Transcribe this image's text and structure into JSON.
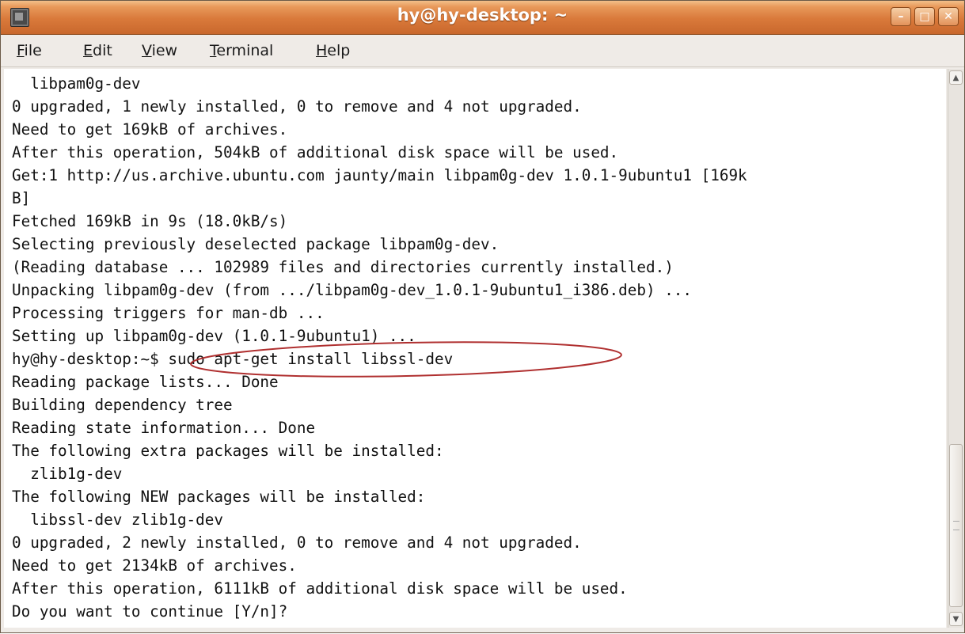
{
  "window": {
    "title": "hy@hy-desktop: ~",
    "buttons": {
      "minimize": "–",
      "maximize": "□",
      "close": "✕"
    },
    "icon": "terminal-app-icon"
  },
  "menubar": {
    "items": [
      {
        "underline": "F",
        "rest": "ile"
      },
      {
        "underline": "E",
        "rest": "dit"
      },
      {
        "underline": "V",
        "rest": "iew"
      },
      {
        "underline": "T",
        "rest": "erminal"
      },
      {
        "underline": "H",
        "rest": "elp"
      }
    ]
  },
  "terminal": {
    "lines": [
      "  libpam0g-dev",
      "0 upgraded, 1 newly installed, 0 to remove and 4 not upgraded.",
      "Need to get 169kB of archives.",
      "After this operation, 504kB of additional disk space will be used.",
      "Get:1 http://us.archive.ubuntu.com jaunty/main libpam0g-dev 1.0.1-9ubuntu1 [169k",
      "B]",
      "Fetched 169kB in 9s (18.0kB/s)",
      "Selecting previously deselected package libpam0g-dev.",
      "(Reading database ... 102989 files and directories currently installed.)",
      "Unpacking libpam0g-dev (from .../libpam0g-dev_1.0.1-9ubuntu1_i386.deb) ...",
      "Processing triggers for man-db ...",
      "Setting up libpam0g-dev (1.0.1-9ubuntu1) ...",
      "hy@hy-desktop:~$ sudo apt-get install libssl-dev",
      "Reading package lists... Done",
      "Building dependency tree",
      "Reading state information... Done",
      "The following extra packages will be installed:",
      "  zlib1g-dev",
      "The following NEW packages will be installed:",
      "  libssl-dev zlib1g-dev",
      "0 upgraded, 2 newly installed, 0 to remove and 4 not upgraded.",
      "Need to get 2134kB of archives.",
      "After this operation, 6111kB of additional disk space will be used.",
      "Do you want to continue [Y/n]?"
    ]
  },
  "scrollbar": {
    "up": "▲",
    "down": "▼"
  },
  "colors": {
    "titlebar": "#d9793a",
    "annotation": "#b03030"
  }
}
